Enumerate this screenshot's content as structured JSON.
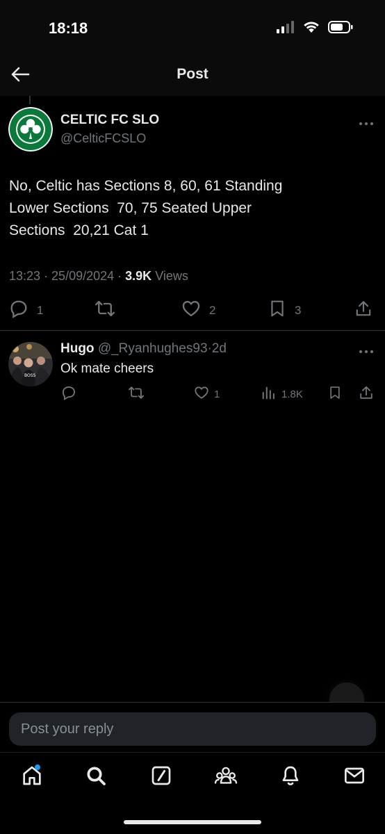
{
  "status_bar": {
    "time": "18:18"
  },
  "header": {
    "title": "Post"
  },
  "post": {
    "author_name": "CELTIC FC SLO",
    "author_handle": "@CelticFCSLO",
    "text_lines": [
      "No, Celtic has Sections 8, 60, 61 Standing",
      "Lower Sections  70, 75 Seated Upper",
      "Sections  20,21 Cat 1"
    ],
    "time": "13:23",
    "date": "25/09/2024",
    "views_count": "3.9K",
    "views_label": "Views",
    "reply_count": "1",
    "like_count": "2",
    "bookmark_count": "3"
  },
  "reply": {
    "name": "Hugo",
    "handle": "@_Ryanhughes93",
    "separator": "·",
    "age": "2d",
    "text": "Ok mate cheers",
    "like_count": "1",
    "views_count": "1.8K"
  },
  "compose": {
    "placeholder": "Post your reply"
  },
  "icons": {
    "back": "arrow-left-icon",
    "more": "more-horizontal-icon",
    "reply": "comment-icon",
    "repost": "repost-icon",
    "like": "heart-icon",
    "bookmark": "bookmark-icon",
    "share": "share-icon",
    "views": "bar-chart-icon",
    "nav": [
      "home-icon",
      "search-icon",
      "grok-icon",
      "communities-icon",
      "bell-icon",
      "mail-icon"
    ]
  },
  "colors": {
    "background": "#000000",
    "text_primary": "#e7e9ea",
    "text_secondary": "#71767b",
    "accent": "#1d9bf0",
    "celtic_green": "#0a7a3a"
  }
}
